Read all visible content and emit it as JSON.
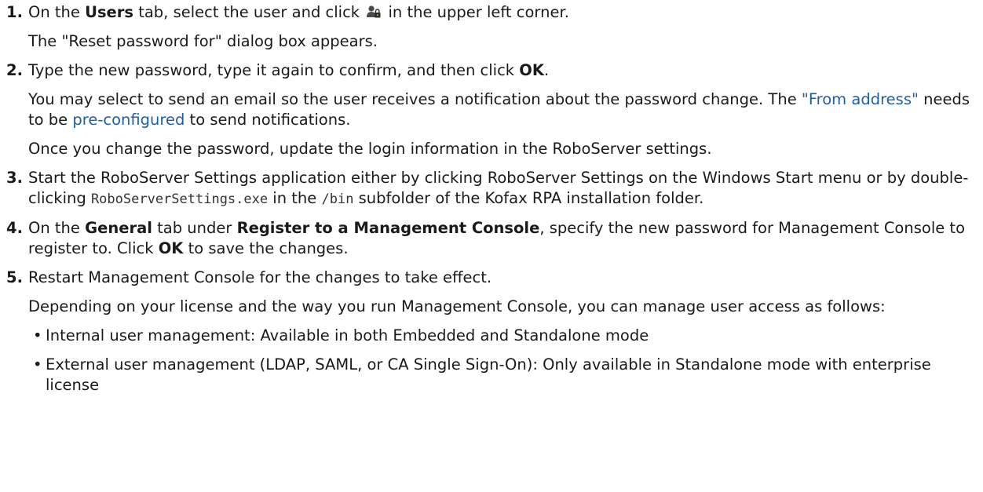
{
  "steps": [
    {
      "num": "1.",
      "t1": "On the ",
      "b1": "Users",
      "t2": " tab, select the user and click ",
      "icon": "reset-password-icon",
      "t3": " in the upper left corner.",
      "note": "The \"Reset password for\" dialog box appears."
    },
    {
      "num": "2.",
      "t1": "Type the new password, type it again to confirm, and then click ",
      "b1": "OK",
      "t2": ".",
      "p1": "You may select to send an email so the user receives a notification about the password change. The ",
      "link1": "\"From address\"",
      "p2": " needs to be ",
      "link2": "pre-configured",
      "p3": " to send notifications.",
      "note": "Once you change the password, update the login information in the RoboServer settings."
    },
    {
      "num": "3.",
      "t1": "Start the RoboServer Settings application either by clicking RoboServer Settings on the Windows Start menu or by double-clicking ",
      "code1": "RoboServerSettings.exe",
      "t2": " in the ",
      "code2": "/bin",
      "t3": " subfolder of the Kofax RPA installation folder."
    },
    {
      "num": "4.",
      "t1": "On the ",
      "b1": "General",
      "t2": " tab under ",
      "b2": "Register to a Management Console",
      "t3": ", specify the new password for Management Console to register to. Click ",
      "b3": "OK",
      "t4": " to save the changes."
    },
    {
      "num": "5.",
      "t1": "Restart Management Console for the changes to take effect.",
      "note": "Depending on your license and the way you run Management Console, you can manage user access as follows:",
      "bullets": [
        "Internal user management: Available in both Embedded and Standalone mode",
        "External user management (LDAP, SAML, or CA Single Sign-On): Only available in Standalone mode with enterprise license"
      ]
    }
  ],
  "bullet_glyph": "•",
  "colors": {
    "link": "#1f5ea8",
    "text": "#1a1a1a"
  }
}
